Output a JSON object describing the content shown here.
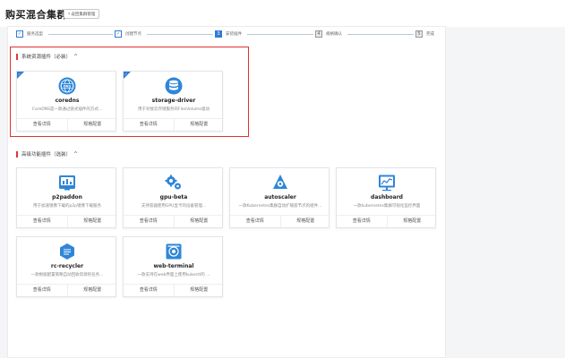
{
  "header": {
    "title": "购买混合集群",
    "back_label": "返回集群管理"
  },
  "steps": [
    {
      "num": "",
      "label": "服务选型",
      "state": "done"
    },
    {
      "num": "",
      "label": "创建节点",
      "state": "done"
    },
    {
      "num": "3",
      "label": "安装插件",
      "state": "active"
    },
    {
      "num": "4",
      "label": "规格确认",
      "state": "future"
    },
    {
      "num": "5",
      "label": "完成",
      "state": "future"
    }
  ],
  "sections": {
    "required": {
      "title": "系统资源插件（必装）",
      "caret": "^"
    },
    "optional": {
      "title": "高级功能插件（选装）",
      "caret": "^"
    }
  },
  "actions": {
    "details": "查看详情",
    "config": "规格配置"
  },
  "required_addons": [
    {
      "name": "coredns",
      "desc": "CoreDNS是一款通过链式插件的方式...",
      "icon": "dns-globe-icon",
      "selected": true
    },
    {
      "name": "storage-driver",
      "desc": "用于对接云存储服务的FlexVolume驱动",
      "icon": "database-icon",
      "selected": true
    }
  ],
  "optional_addons": [
    {
      "name": "p2paddon",
      "desc": "用于加速镜像下载的p2p镜像下载服务",
      "icon": "p2p-network-icon"
    },
    {
      "name": "gpu-beta",
      "desc": "支持容器使用GPU显卡的设备管理...",
      "icon": "gears-icon"
    },
    {
      "name": "autoscaler",
      "desc": "一款Kubernetes集群自动扩缩容节点的组件...",
      "icon": "autoscaler-icon"
    },
    {
      "name": "dashboard",
      "desc": "一款kubernetes集群可视化监控界面",
      "icon": "dashboard-chart-icon"
    },
    {
      "name": "rc-recycler",
      "desc": "一款根据配置策略自动回收资源的任务...",
      "icon": "recycler-icon"
    },
    {
      "name": "web-terminal",
      "desc": "一款支持在web界面上使用kubectl的 ...",
      "icon": "terminal-icon"
    }
  ],
  "colors": {
    "accent": "#2f7bd6",
    "highlight": "#e03131",
    "icon_bg": "#2f86d8"
  }
}
